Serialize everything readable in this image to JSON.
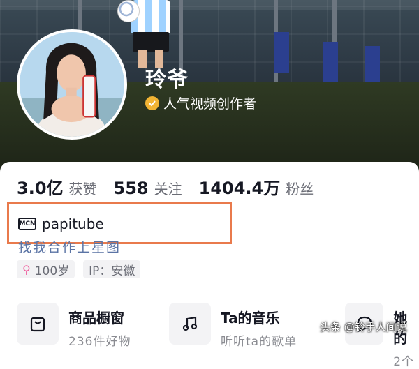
{
  "profile": {
    "name": "玲爷",
    "verified_label": "人气视频创作者"
  },
  "stats": [
    {
      "value": "3.0亿",
      "label": "获赞"
    },
    {
      "value": "558",
      "label": "关注"
    },
    {
      "value": "1404.4万",
      "label": "粉丝"
    }
  ],
  "mcn": {
    "icon_text": "MCN",
    "name": "papitube"
  },
  "partner_link": "找我合作上星图",
  "tags": [
    {
      "icon": "female-gender-icon",
      "text": "100岁"
    },
    {
      "text": "IP：安徽"
    }
  ],
  "shortcuts": [
    {
      "icon": "shopping-bag-icon",
      "title": "商品橱窗",
      "subtitle": "236件好物"
    },
    {
      "icon": "music-note-icon",
      "title": "Ta的音乐",
      "subtitle": "听听ta的歌单"
    },
    {
      "icon": "chat-bubble-icon",
      "title": "她的",
      "subtitle": "2个"
    }
  ],
  "watermark": "头条 @铃手人间说",
  "colors": {
    "highlight_box": "#e97a4c",
    "verify_badge": "#f2b434",
    "link": "#5b74a5"
  }
}
